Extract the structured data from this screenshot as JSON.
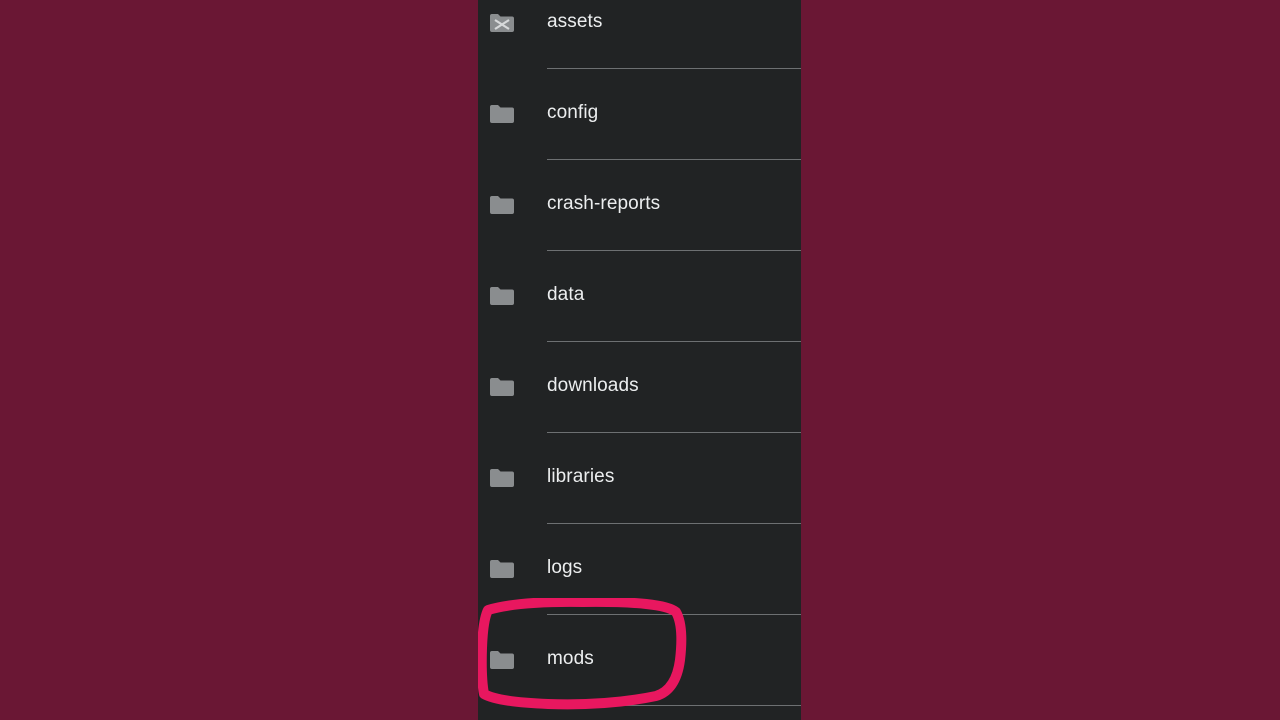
{
  "file_list": {
    "items": [
      {
        "name": "assets",
        "icon": "folder-icon"
      },
      {
        "name": "config",
        "icon": "folder-icon"
      },
      {
        "name": "crash-reports",
        "icon": "folder-icon"
      },
      {
        "name": "data",
        "icon": "folder-icon"
      },
      {
        "name": "downloads",
        "icon": "folder-icon"
      },
      {
        "name": "libraries",
        "icon": "folder-icon"
      },
      {
        "name": "logs",
        "icon": "folder-icon"
      },
      {
        "name": "mods",
        "icon": "folder-icon"
      }
    ]
  },
  "colors": {
    "background": "#6a1734",
    "panel": "#212324",
    "text": "#eceeef",
    "divider": "#6d7072",
    "folder_icon": "#8a8d8f",
    "highlight_stroke": "#e8175f"
  },
  "annotation": {
    "highlighted_item": "mods",
    "icon": "circle-highlight-annotation"
  }
}
